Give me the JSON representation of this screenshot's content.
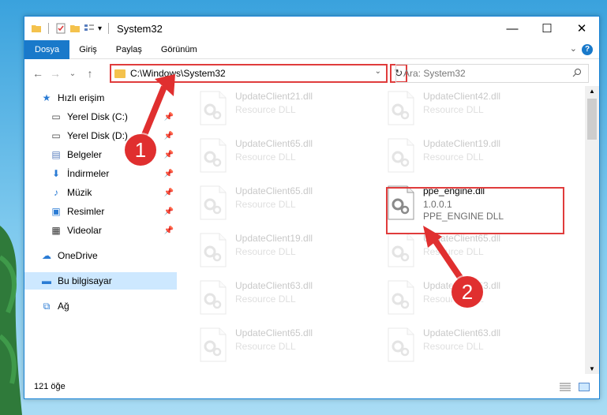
{
  "window": {
    "title": "System32",
    "minimize": "—",
    "maximize": "☐",
    "close": "✕"
  },
  "ribbon": {
    "tabs": [
      "Dosya",
      "Giriş",
      "Paylaş",
      "Görünüm"
    ],
    "help": "?",
    "expand": "⌄"
  },
  "navbar": {
    "back": "←",
    "forward": "→",
    "recent": "⌄",
    "up": "↑",
    "path": "C:\\Windows\\System32",
    "refresh": "↻",
    "search_placeholder": "Ara: System32"
  },
  "sidebar": {
    "items": [
      {
        "label": "Hızlı erişim",
        "icon": "star-icon",
        "pinned": false
      },
      {
        "label": "Yerel Disk (C:)",
        "icon": "drive-icon",
        "pinned": true
      },
      {
        "label": "Yerel Disk (D:)",
        "icon": "drive-icon",
        "pinned": true
      },
      {
        "label": "Belgeler",
        "icon": "documents-icon",
        "pinned": true
      },
      {
        "label": "İndirmeler",
        "icon": "download-icon",
        "pinned": true
      },
      {
        "label": "Müzik",
        "icon": "music-icon",
        "pinned": true
      },
      {
        "label": "Resimler",
        "icon": "pictures-icon",
        "pinned": true
      },
      {
        "label": "Videolar",
        "icon": "videos-icon",
        "pinned": true
      },
      {
        "label": "OneDrive",
        "icon": "cloud-icon",
        "pinned": false
      },
      {
        "label": "Bu bilgisayar",
        "icon": "computer-icon",
        "pinned": false,
        "selected": true
      },
      {
        "label": "Ağ",
        "icon": "network-icon",
        "pinned": false
      }
    ]
  },
  "files": [
    {
      "name": "UpdateClient21.dll",
      "desc": "Resource DLL",
      "faded": true
    },
    {
      "name": "UpdateClient42.dll",
      "desc": "Resource DLL",
      "faded": true
    },
    {
      "name": "UpdateClient65.dll",
      "desc": "Resource DLL",
      "faded": true
    },
    {
      "name": "UpdateClient19.dll",
      "desc": "Resource DLL",
      "faded": true
    },
    {
      "name": "UpdateClient65.dll",
      "desc": "Resource DLL",
      "faded": true
    },
    {
      "name": "ppe_engine.dll",
      "version": "1.0.0.1",
      "desc": "PPE_ENGINE DLL",
      "faded": false
    },
    {
      "name": "UpdateClient19.dll",
      "desc": "Resource DLL",
      "faded": true
    },
    {
      "name": "UpdateClient65.dll",
      "desc": "Resource DLL",
      "faded": true
    },
    {
      "name": "UpdateClient63.dll",
      "desc": "Resource DLL",
      "faded": true
    },
    {
      "name": "UpdateClient63.dll",
      "desc": "Resource DLL",
      "faded": true
    },
    {
      "name": "UpdateClient65.dll",
      "desc": "Resource DLL",
      "faded": true
    },
    {
      "name": "UpdateClient63.dll",
      "desc": "Resource DLL",
      "faded": true
    }
  ],
  "status": {
    "count": "121 öğe"
  },
  "annotations": {
    "step1": "1",
    "step2": "2"
  },
  "colors": {
    "accent": "#1979ca",
    "highlight": "#e03c3c",
    "selected": "#cde8ff"
  }
}
